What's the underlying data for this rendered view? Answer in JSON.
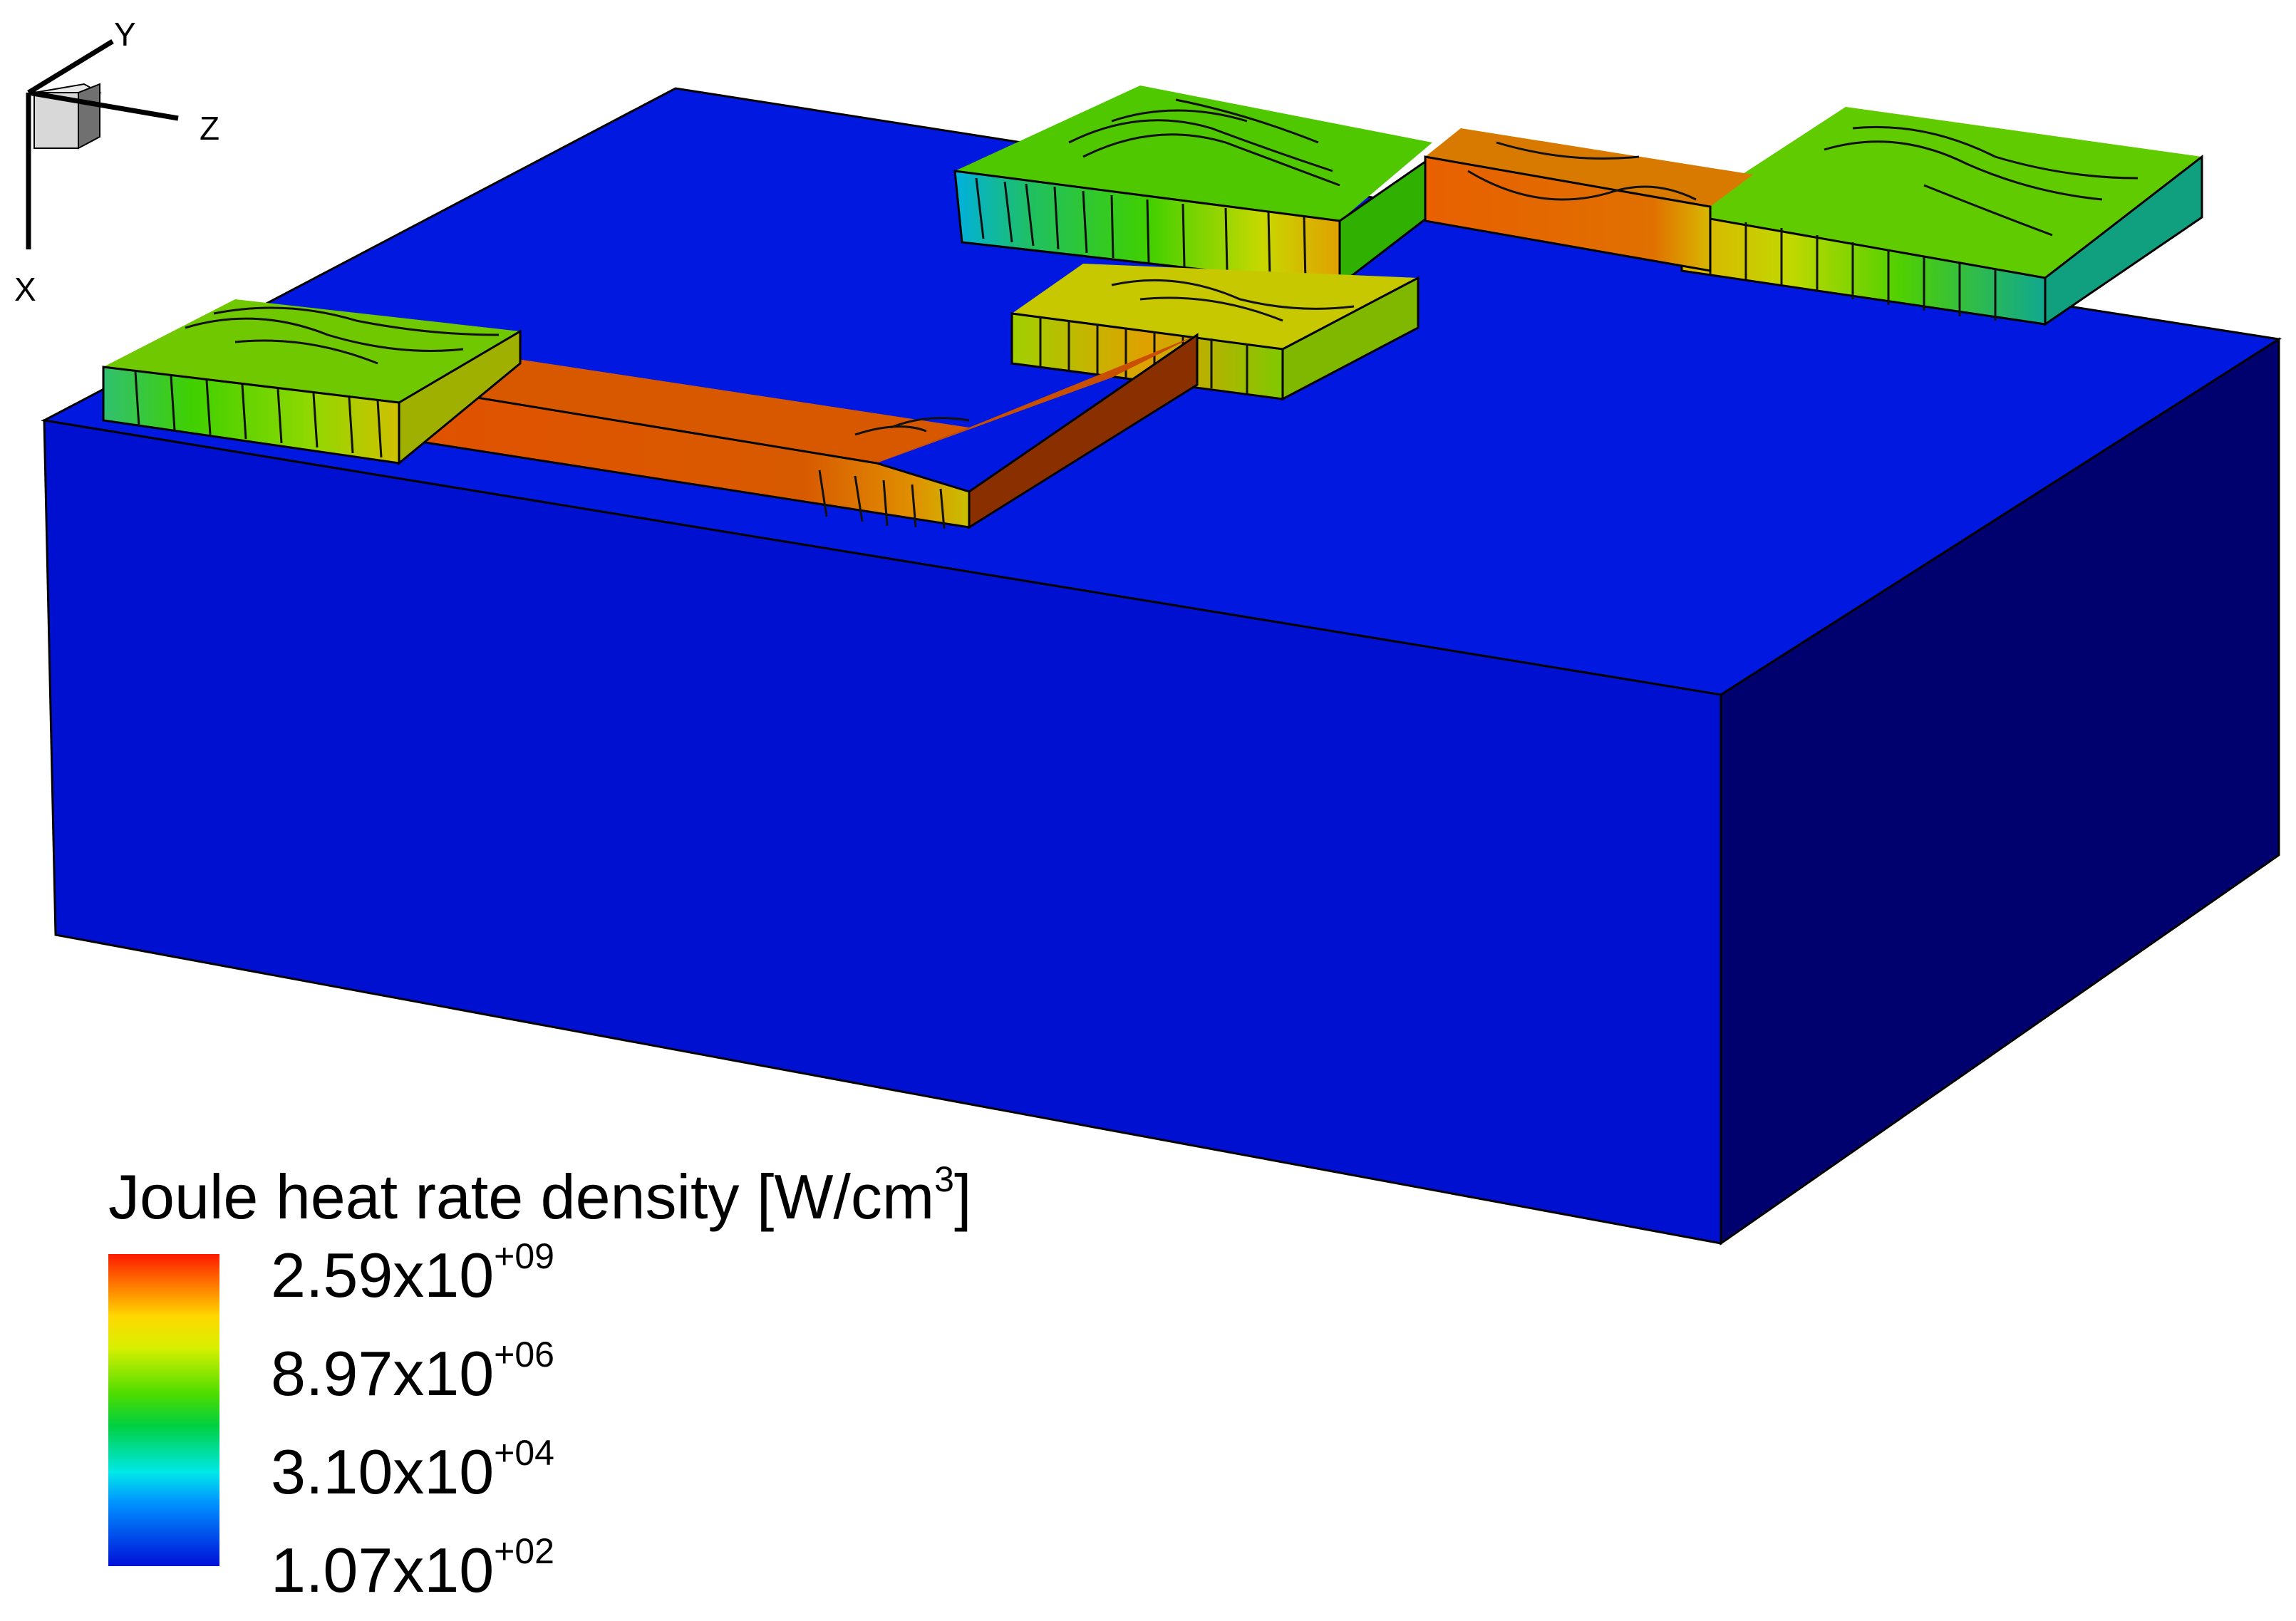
{
  "axes": {
    "x_label": "X",
    "y_label": "Y",
    "z_label": "Z"
  },
  "legend": {
    "title_main": "Joule heat rate density [W/cm",
    "title_sup": "3",
    "title_end": "]",
    "entries": [
      {
        "mantissa": "2.59x10",
        "exponent": "+09"
      },
      {
        "mantissa": "8.97x10",
        "exponent": "+06"
      },
      {
        "mantissa": "3.10x10",
        "exponent": "+04"
      },
      {
        "mantissa": "1.07x10",
        "exponent": "+02"
      }
    ],
    "gradient_colors": [
      "#ff1a00",
      "#ff7a00",
      "#ffd800",
      "#d8f000",
      "#4cdc00",
      "#00d040",
      "#00e8e8",
      "#0090ff",
      "#0010d8"
    ]
  },
  "colors": {
    "substrate_top": "#0018e0",
    "substrate_front": "#0010d0",
    "substrate_side": "#00007a",
    "trace_hot": "#d85000",
    "trace_mid": "#e08000",
    "pad_green": "#50d000",
    "pad_yellow": "#d8d800",
    "pad_cyan": "#00b0d0"
  }
}
